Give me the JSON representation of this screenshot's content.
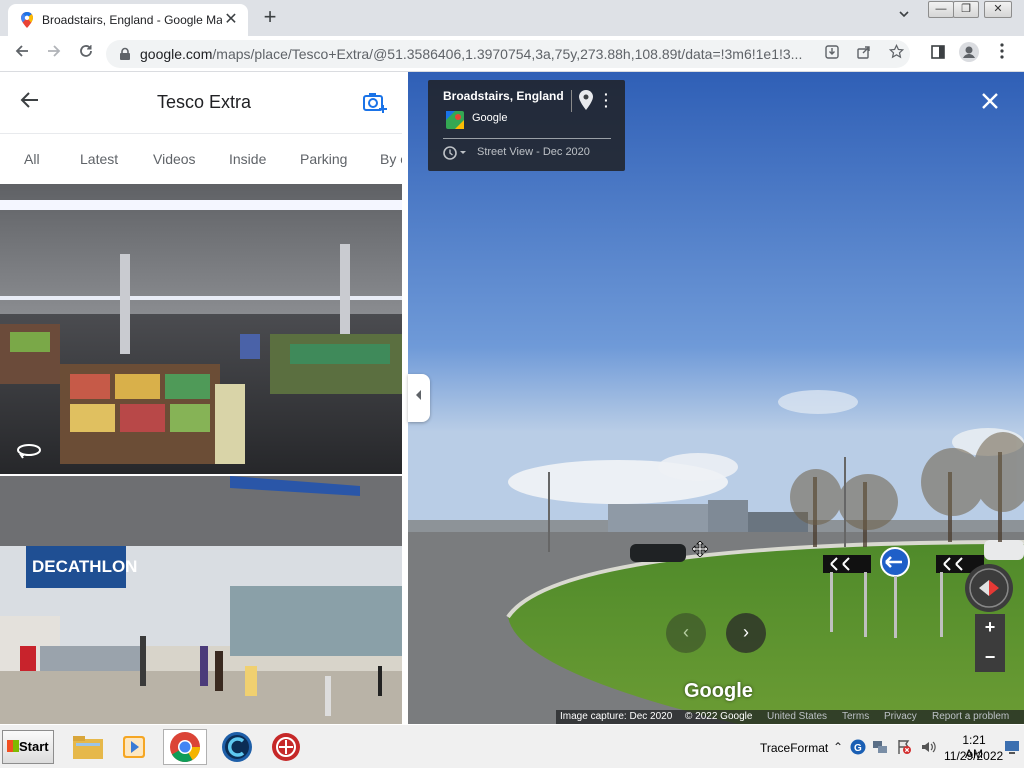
{
  "browser": {
    "tab_title": "Broadstairs, England - Google Maps",
    "new_tab": "+",
    "tab_close": "✕",
    "url_host": "google.com",
    "url_path": "/maps/place/Tesco+Extra/@51.3586406,1.3970754,3a,75y,273.88h,108.89t/data=!3m6!1e1!3...",
    "window_min": "—",
    "window_max": "❐",
    "window_close": "✕"
  },
  "panel": {
    "title": "Tesco Extra",
    "tabs": [
      "All",
      "Latest",
      "Videos",
      "Inside",
      "Parking",
      "By o"
    ]
  },
  "streetview": {
    "place": "Broadstairs, England",
    "provider": "Google",
    "capture_label": "Street View - Dec 2020",
    "watermark": "Google",
    "footer": {
      "capture": "Image capture: Dec 2020",
      "copyright": "© 2022 Google",
      "country": "United States",
      "terms": "Terms",
      "privacy": "Privacy",
      "report": "Report a problem"
    },
    "zoom_in": "+",
    "zoom_out": "−"
  },
  "taskbar": {
    "start_label": "Start",
    "tray_label": "TraceFormat",
    "time": "1:21 AM",
    "date": "11/29/2022"
  },
  "colors": {
    "sky": "#4a79c8",
    "grass": "#5a8a2a",
    "maps_blue": "#1a73e8"
  }
}
